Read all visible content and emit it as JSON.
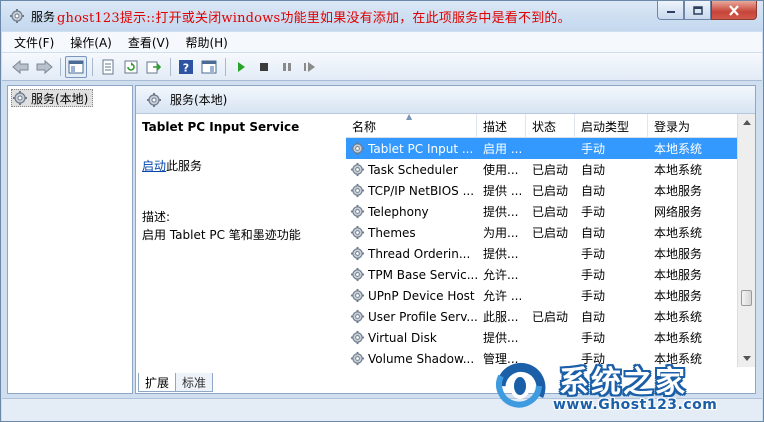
{
  "window": {
    "title": "服务",
    "note": "ghost123提示::打开或关闭windows功能里如果没有添加，在此项服务中是看不到的。"
  },
  "menu": [
    "文件(F)",
    "操作(A)",
    "查看(V)",
    "帮助(H)"
  ],
  "tree": {
    "root_label": "服务(本地)"
  },
  "content": {
    "header_title": "服务(本地)",
    "service_name": "Tablet PC Input Service",
    "start_link": "启动",
    "start_suffix": "此服务",
    "desc_label": "描述:",
    "desc_text": "启用 Tablet PC 笔和墨迹功能"
  },
  "list": {
    "columns": [
      "名称",
      "描述",
      "状态",
      "启动类型",
      "登录为"
    ],
    "rows": [
      {
        "name": "Tablet PC Input ...",
        "desc": "启用 ...",
        "status": "",
        "startup": "手动",
        "logon": "本地系统"
      },
      {
        "name": "Task Scheduler",
        "desc": "使用...",
        "status": "已启动",
        "startup": "自动",
        "logon": "本地系统"
      },
      {
        "name": "TCP/IP NetBIOS ...",
        "desc": "提供 ...",
        "status": "已启动",
        "startup": "自动",
        "logon": "本地服务"
      },
      {
        "name": "Telephony",
        "desc": "提供...",
        "status": "已启动",
        "startup": "手动",
        "logon": "网络服务"
      },
      {
        "name": "Themes",
        "desc": "为用...",
        "status": "已启动",
        "startup": "自动",
        "logon": "本地系统"
      },
      {
        "name": "Thread Orderin...",
        "desc": "提供...",
        "status": "",
        "startup": "手动",
        "logon": "本地服务"
      },
      {
        "name": "TPM Base Servic...",
        "desc": "允许...",
        "status": "",
        "startup": "手动",
        "logon": "本地服务"
      },
      {
        "name": "UPnP Device Host",
        "desc": "允许 ...",
        "status": "",
        "startup": "手动",
        "logon": "本地服务"
      },
      {
        "name": "User Profile Serv...",
        "desc": "此服...",
        "status": "已启动",
        "startup": "自动",
        "logon": "本地系统"
      },
      {
        "name": "Virtual Disk",
        "desc": "提供...",
        "status": "",
        "startup": "手动",
        "logon": "本地系统"
      },
      {
        "name": "Volume Shadow...",
        "desc": "管理...",
        "status": "",
        "startup": "手动",
        "logon": "本地系统"
      }
    ]
  },
  "tabs": [
    "扩展",
    "标准"
  ],
  "watermark": {
    "brand": "系统之家",
    "url": "www.Ghost123.com"
  },
  "colors": {
    "note_red": "#e00000",
    "selection": "#3399ff",
    "link": "#0645ad",
    "brand_blue": "#1a5fa8"
  }
}
